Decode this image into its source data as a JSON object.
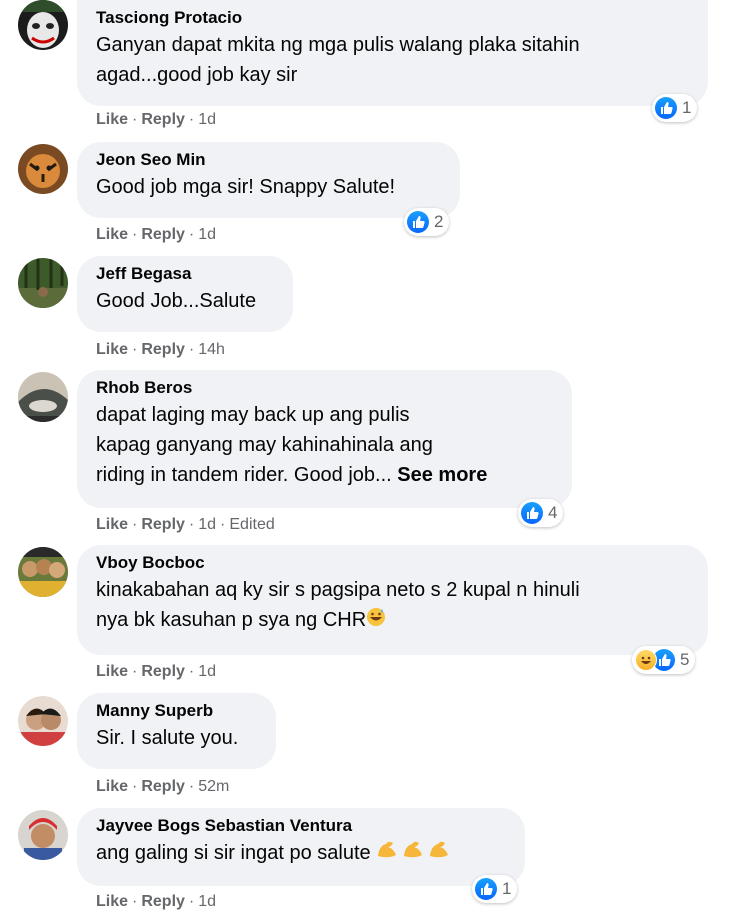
{
  "comments": [
    {
      "name": "Tasciong Protacio",
      "lines": [
        "Ganyan dapat mkita ng mga pulis walang plaka sitahin",
        "agad...good job kay sir"
      ],
      "like": "Like",
      "reply": "Reply",
      "time": "1d",
      "reaction_count": "1"
    },
    {
      "name": "Jeon Seo Min",
      "lines": [
        "Good job mga sir! Snappy Salute!"
      ],
      "like": "Like",
      "reply": "Reply",
      "time": "1d",
      "reaction_count": "2"
    },
    {
      "name": "Jeff Begasa",
      "lines": [
        "Good Job...Salute"
      ],
      "like": "Like",
      "reply": "Reply",
      "time": "14h"
    },
    {
      "name": "Rhob Beros",
      "lines": [
        "dapat laging may back up ang pulis",
        "kapag ganyang may kahinahinala ang",
        "riding in tandem rider. Good job... "
      ],
      "see_more": "See more",
      "like": "Like",
      "reply": "Reply",
      "time": "1d",
      "edited": "Edited",
      "reaction_count": "4"
    },
    {
      "name": "Vboy Bocboc",
      "lines": [
        "kinakabahan aq ky sir s pagsipa neto s 2 kupal n hinuli",
        "nya bk kasuhan p sya ng CHR"
      ],
      "like": "Like",
      "reply": "Reply",
      "time": "1d",
      "reaction_count": "5"
    },
    {
      "name": "Manny Superb",
      "lines": [
        "Sir. I salute you."
      ],
      "like": "Like",
      "reply": "Reply",
      "time": "52m"
    },
    {
      "name": "Jayvee Bogs Sebastian Ventura",
      "lines": [
        "ang galing si sir ingat po salute "
      ],
      "like": "Like",
      "reply": "Reply",
      "time": "1d",
      "reaction_count": "1"
    }
  ],
  "icons": {
    "like": "like-reaction-icon",
    "haha": "haha-reaction-icon",
    "flex": "flexed-biceps-emoji",
    "grin": "grinning-sweat-emoji"
  },
  "colors": {
    "bubble": "#f0f2f5",
    "meta": "#65676b",
    "like_blue": "#0866ff"
  }
}
